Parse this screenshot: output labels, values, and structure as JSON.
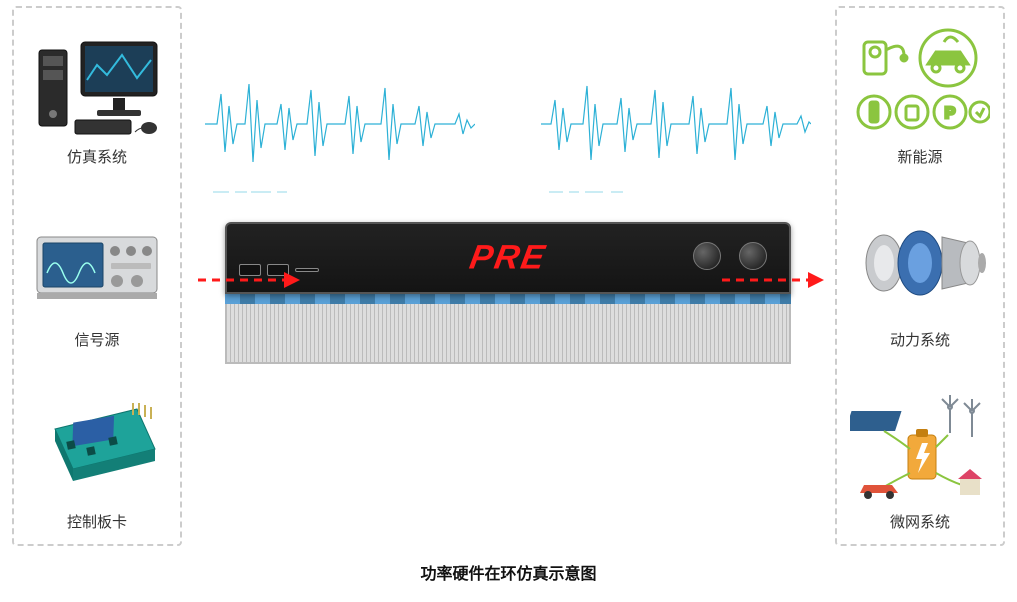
{
  "diagram": {
    "caption": "功率硬件在环仿真示意图",
    "brand": "PRE",
    "left_items": [
      {
        "label": "仿真系统",
        "name": "simulation-system"
      },
      {
        "label": "信号源",
        "name": "signal-source"
      },
      {
        "label": "控制板卡",
        "name": "control-board"
      }
    ],
    "right_items": [
      {
        "label": "新能源",
        "name": "new-energy"
      },
      {
        "label": "动力系统",
        "name": "power-system"
      },
      {
        "label": "微网系统",
        "name": "microgrid-system"
      }
    ],
    "colors": {
      "arrow": "#ff1a1a",
      "wave": "#2db1d6",
      "border": "#cccccc",
      "green": "#8bc53f",
      "board": "#1ea39a"
    }
  }
}
